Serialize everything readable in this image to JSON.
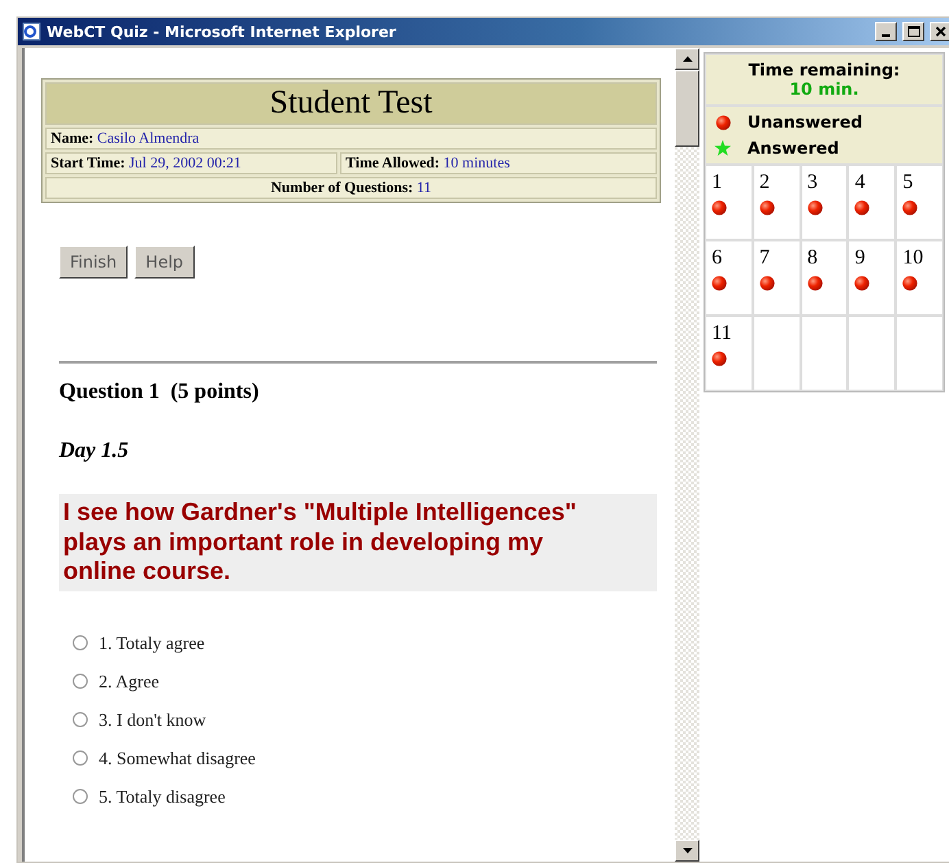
{
  "window": {
    "title": "WebCT Quiz - Microsoft Internet Explorer"
  },
  "test": {
    "title": "Student Test",
    "name_label": "Name:",
    "name": "Casilo Almendra",
    "start_label": "Start Time:",
    "start": "Jul 29, 2002 00:21",
    "allowed_label": "Time Allowed:",
    "allowed": "10 minutes",
    "count_label": "Number of Questions:",
    "count": "11"
  },
  "buttons": [
    "Finish",
    "Help"
  ],
  "question": {
    "heading": "Question 1  (5 points)",
    "title": "Day 1.5",
    "prompt": "I see how Gardner's \"Multiple Intelligences\" plays an important role in developing my online course.",
    "options": [
      {
        "label": "1. Totaly agree",
        "selected": false
      },
      {
        "label": "2. Agree",
        "selected": false
      },
      {
        "label": "3. I don't know",
        "selected": false
      },
      {
        "label": "4. Somewhat disagree",
        "selected": false
      },
      {
        "label": "5. Totaly disagree",
        "selected": false
      }
    ]
  },
  "timer": {
    "label": "Time remaining:",
    "value": "10 min."
  },
  "legend": [
    {
      "kind": "unanswered",
      "label": "Unanswered"
    },
    {
      "kind": "answered",
      "label": "Answered"
    }
  ],
  "questions": [
    {
      "number": "1",
      "answered": false
    },
    {
      "number": "2",
      "answered": false
    },
    {
      "number": "3",
      "answered": false
    },
    {
      "number": "4",
      "answered": false
    },
    {
      "number": "5",
      "answered": false
    },
    {
      "number": "6",
      "answered": false
    },
    {
      "number": "7",
      "answered": false
    },
    {
      "number": "8",
      "answered": false
    },
    {
      "number": "9",
      "answered": false
    },
    {
      "number": "10",
      "answered": false
    },
    {
      "number": "11",
      "answered": false
    }
  ]
}
